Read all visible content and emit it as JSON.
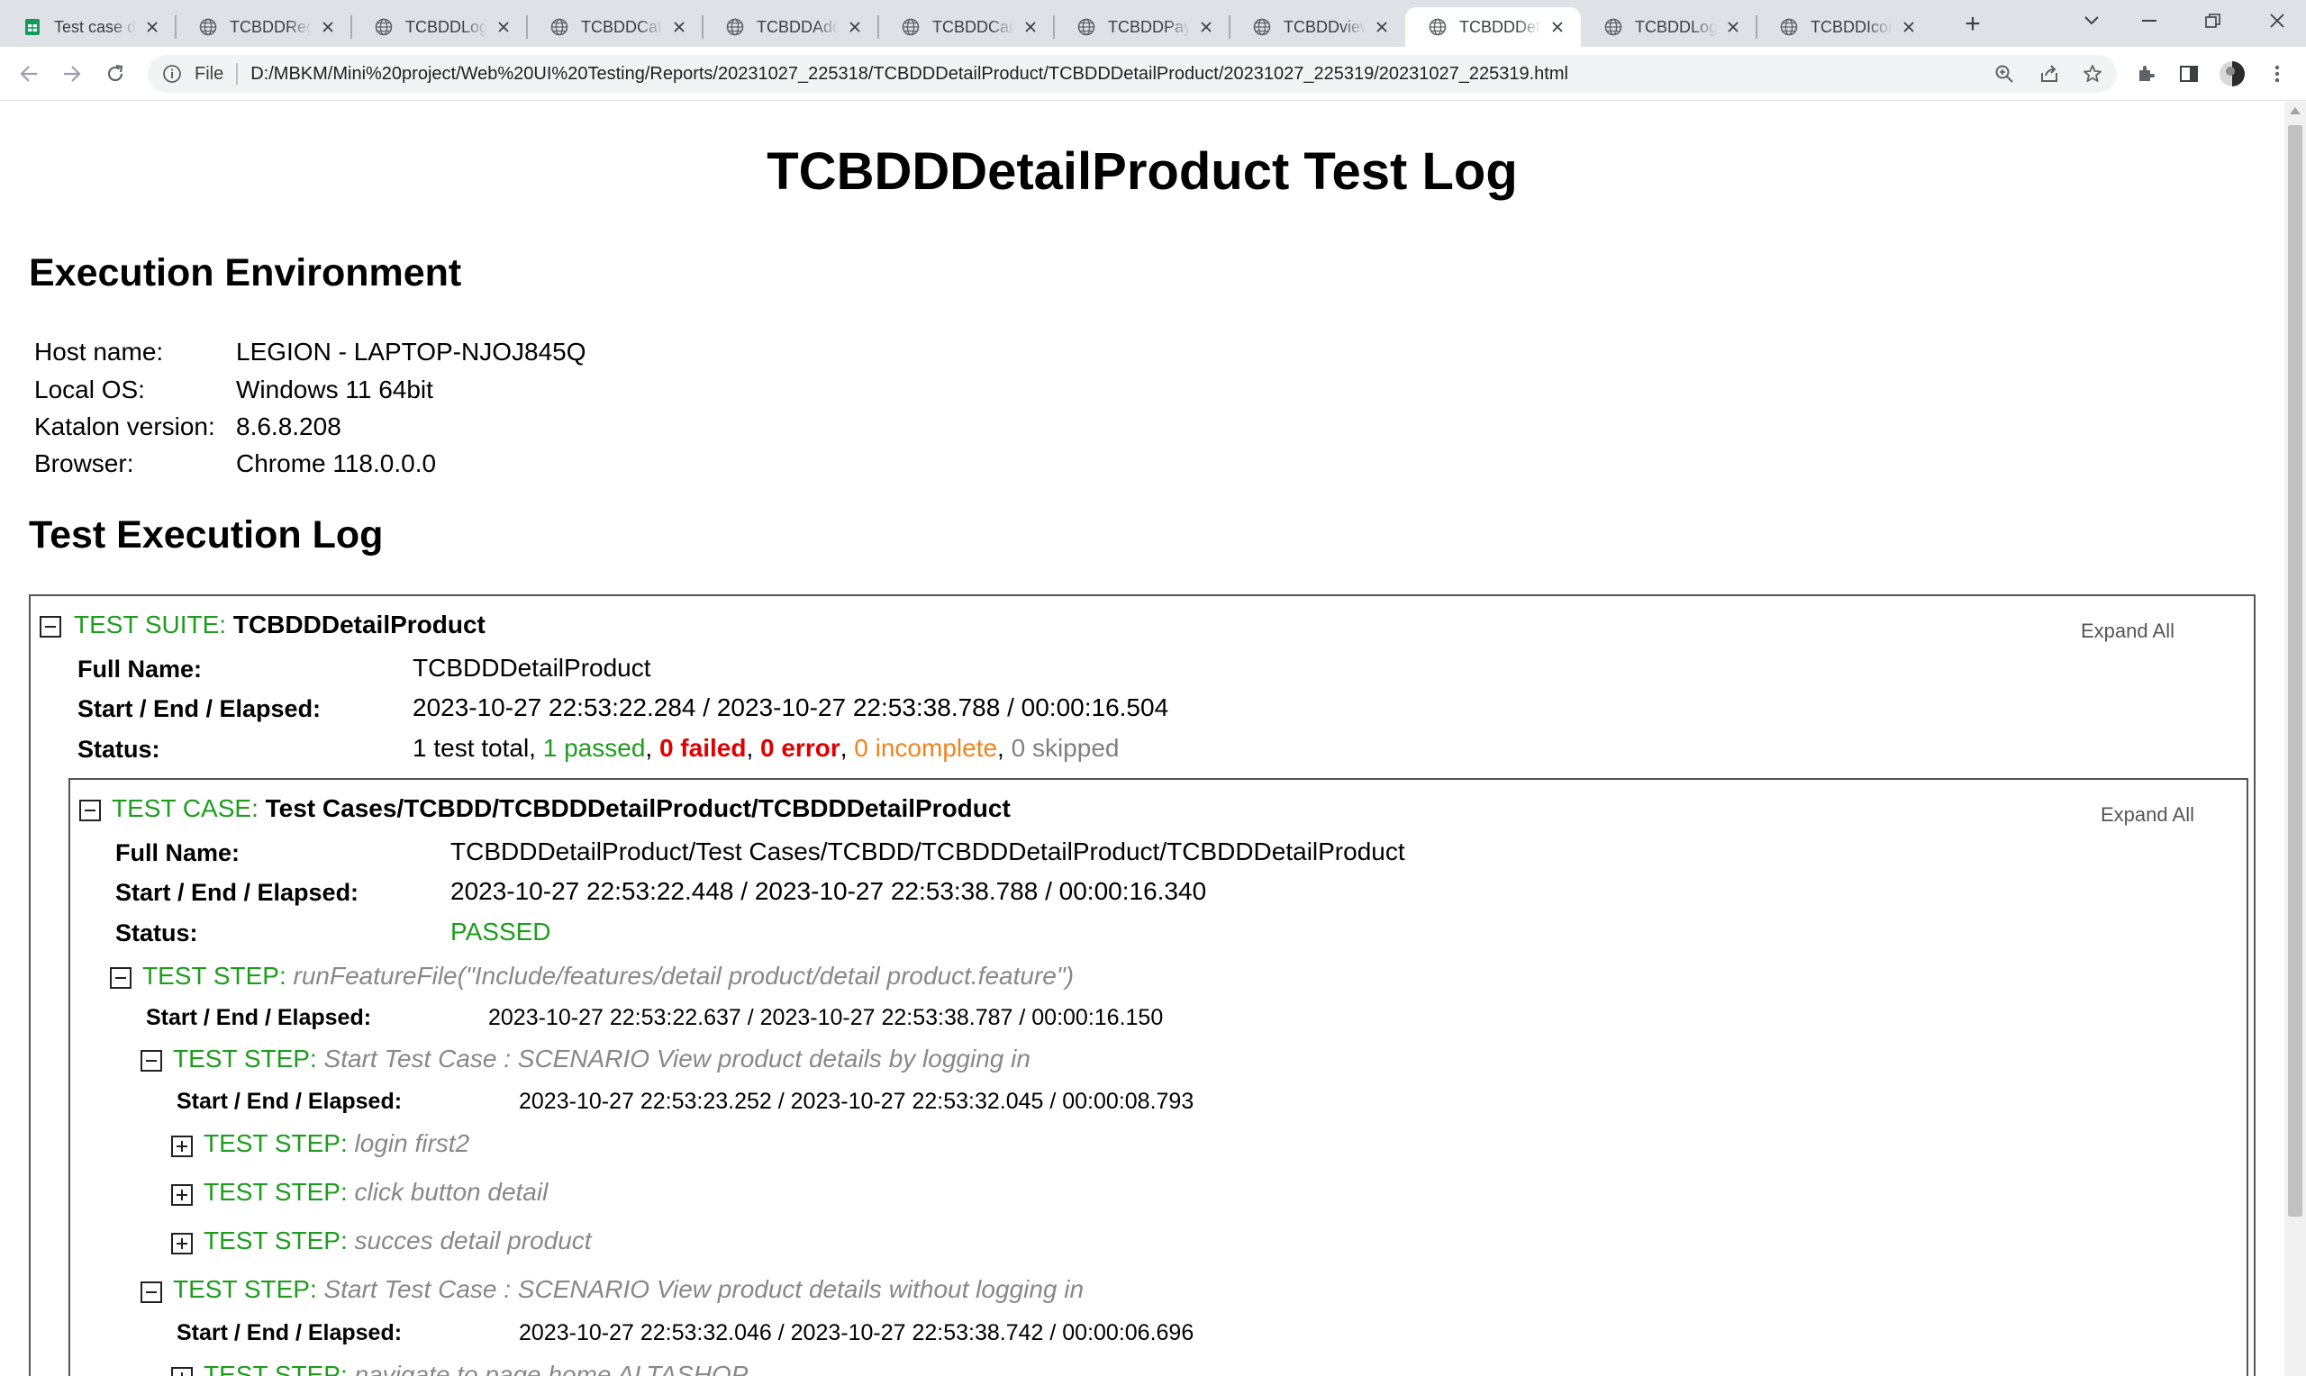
{
  "browser": {
    "tabs": [
      {
        "title": "Test case de",
        "icon": "sheets-icon"
      },
      {
        "title": "TCBDDRegi",
        "icon": "globe-icon"
      },
      {
        "title": "TCBDDLogi",
        "icon": "globe-icon"
      },
      {
        "title": "TCBDDCate",
        "icon": "globe-icon"
      },
      {
        "title": "TCBDDAdd",
        "icon": "globe-icon"
      },
      {
        "title": "TCBDDCart",
        "icon": "globe-icon"
      },
      {
        "title": "TCBDDPaym",
        "icon": "globe-icon"
      },
      {
        "title": "TCBDDview",
        "icon": "globe-icon"
      },
      {
        "title": "TCBDDDeta",
        "icon": "globe-icon",
        "active": true
      },
      {
        "title": "TCBDDLogo",
        "icon": "globe-icon"
      },
      {
        "title": "TCBDDIcon",
        "icon": "globe-icon"
      }
    ],
    "address": {
      "scheme_label": "File",
      "url": "D:/MBKM/Mini%20project/Web%20UI%20Testing/Reports/20231027_225318/TCBDDDetailProduct/TCBDDDetailProduct/20231027_225319/20231027_225319.html"
    }
  },
  "report": {
    "title": "TCBDDDetailProduct Test Log",
    "env_heading": "Execution Environment",
    "env": [
      {
        "label": "Host name:",
        "value": "LEGION - LAPTOP-NJOJ845Q"
      },
      {
        "label": "Local OS:",
        "value": "Windows 11 64bit"
      },
      {
        "label": "Katalon version:",
        "value": "8.6.8.208"
      },
      {
        "label": "Browser:",
        "value": "Chrome 118.0.0.0"
      }
    ],
    "log_heading": "Test Execution Log",
    "suite": {
      "prefix": "TEST SUITE:",
      "name": "TCBDDDetailProduct",
      "expand_all": "Expand All",
      "full_name_label": "Full Name:",
      "full_name": "TCBDDDetailProduct",
      "time_label": "Start / End / Elapsed:",
      "time": "2023-10-27 22:53:22.284 / 2023-10-27 22:53:38.788 / 00:00:16.504",
      "status_label": "Status:",
      "status": {
        "total": "1 test total,",
        "passed": "1 passed",
        "failed": "0 failed",
        "error": "0 error",
        "incomplete": "0 incomplete",
        "skipped": "0 skipped"
      }
    },
    "case": {
      "prefix": "TEST CASE:",
      "name": "Test Cases/TCBDD/TCBDDDetailProduct/TCBDDDetailProduct",
      "expand_all": "Expand All",
      "full_name_label": "Full Name:",
      "full_name": "TCBDDDetailProduct/Test Cases/TCBDD/TCBDDDetailProduct/TCBDDDetailProduct",
      "time_label": "Start / End / Elapsed:",
      "time": "2023-10-27 22:53:22.448 / 2023-10-27 22:53:38.788 / 00:00:16.340",
      "status_label": "Status:",
      "status": "PASSED"
    },
    "steps": {
      "prefix": "TEST STEP:",
      "time_label": "Start / End / Elapsed:",
      "run_feature": {
        "name": "runFeatureFile(\"Include/features/detail product/detail product.feature\")",
        "time": "2023-10-27 22:53:22.637 / 2023-10-27 22:53:38.787 / 00:00:16.150"
      },
      "scenario1": {
        "name": "Start Test Case : SCENARIO View product details by logging in",
        "time": "2023-10-27 22:53:23.252 / 2023-10-27 22:53:32.045 / 00:00:08.793",
        "children": [
          "login first2",
          "click button detail",
          "succes detail product"
        ]
      },
      "scenario2": {
        "name": "Start Test Case : SCENARIO View product details without logging in",
        "time": "2023-10-27 22:53:32.046 / 2023-10-27 22:53:38.742 / 00:00:06.696",
        "next_child": "navigate to page home ALTASHOP"
      }
    }
  }
}
